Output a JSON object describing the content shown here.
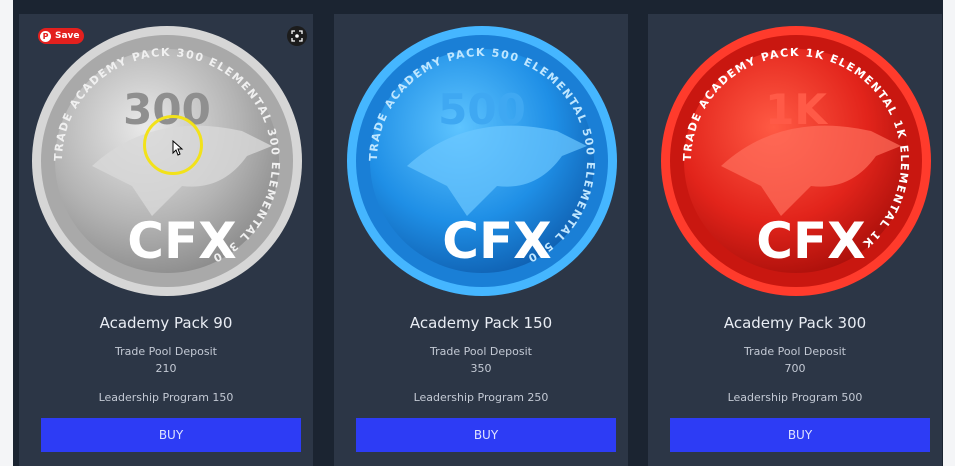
{
  "overlay": {
    "save_label": "Save",
    "pin_glyph": "P",
    "save_icon": "pinterest-icon",
    "lens_icon": "visual-search-icon"
  },
  "colors": {
    "page_bg": "#1b2431",
    "card_bg": "#2c3646",
    "button_bg": "#2d3cf5",
    "silver": "#b9b9b9",
    "blue": "#1f8fe6",
    "red": "#e2241b"
  },
  "cards": [
    {
      "coin": {
        "amount": "300",
        "ring_text": "TRADE ACADEMY PACK 300 ELEMENTAL 300 ELEMENTAL 300",
        "logo": "CFX",
        "theme": "silver"
      },
      "title": "Academy Pack 90",
      "deposit_label": "Trade Pool Deposit",
      "deposit_value": "210",
      "leadership": "Leadership Program 150",
      "buy_label": "BUY"
    },
    {
      "coin": {
        "amount": "500",
        "ring_text": "TRADE ACADEMY PACK 500 ELEMENTAL 500 ELEMENTAL 500",
        "logo": "CFX",
        "theme": "blue"
      },
      "title": "Academy Pack 150",
      "deposit_label": "Trade Pool Deposit",
      "deposit_value": "350",
      "leadership": "Leadership Program 250",
      "buy_label": "BUY"
    },
    {
      "coin": {
        "amount": "1K",
        "ring_text": "TRADE ACADEMY PACK 1K ELEMENTAL 1K ELEMENTAL 1K",
        "logo": "CFX",
        "theme": "red"
      },
      "title": "Academy Pack 300",
      "deposit_label": "Trade Pool Deposit",
      "deposit_value": "700",
      "leadership": "Leadership Program 500",
      "buy_label": "BUY"
    }
  ]
}
